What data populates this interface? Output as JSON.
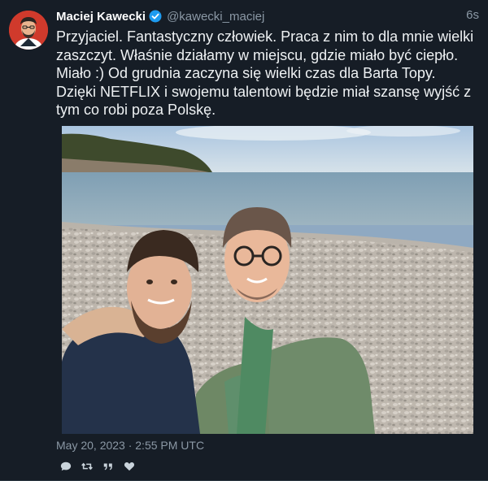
{
  "tweet": {
    "author": {
      "fullname": "Maciej Kawecki",
      "username": "@kawecki_maciej",
      "verified": true
    },
    "time_ago": "6s",
    "text": "Przyjaciel. Fantastyczny człowiek. Praca z nim to dla mnie wielki zaszczyt. Właśnie działamy w miejscu, gdzie miało być ciepło. Miało :) Od grudnia zaczyna się wielki czas dla Barta Topy. Dzięki NETFLIX i swojemu talentowi będzie miał szansę wyjść z tym co robi poza Polskę.",
    "date": "May 20, 2023 · 2:55 PM UTC",
    "actions": [
      {
        "icon": "reply-icon"
      },
      {
        "icon": "retweet-icon"
      },
      {
        "icon": "quote-icon"
      },
      {
        "icon": "like-icon"
      }
    ]
  },
  "colors": {
    "background": "#161d26",
    "text": "#eef1f3",
    "muted": "#8b98a5",
    "verified": "#1d9bf0"
  }
}
